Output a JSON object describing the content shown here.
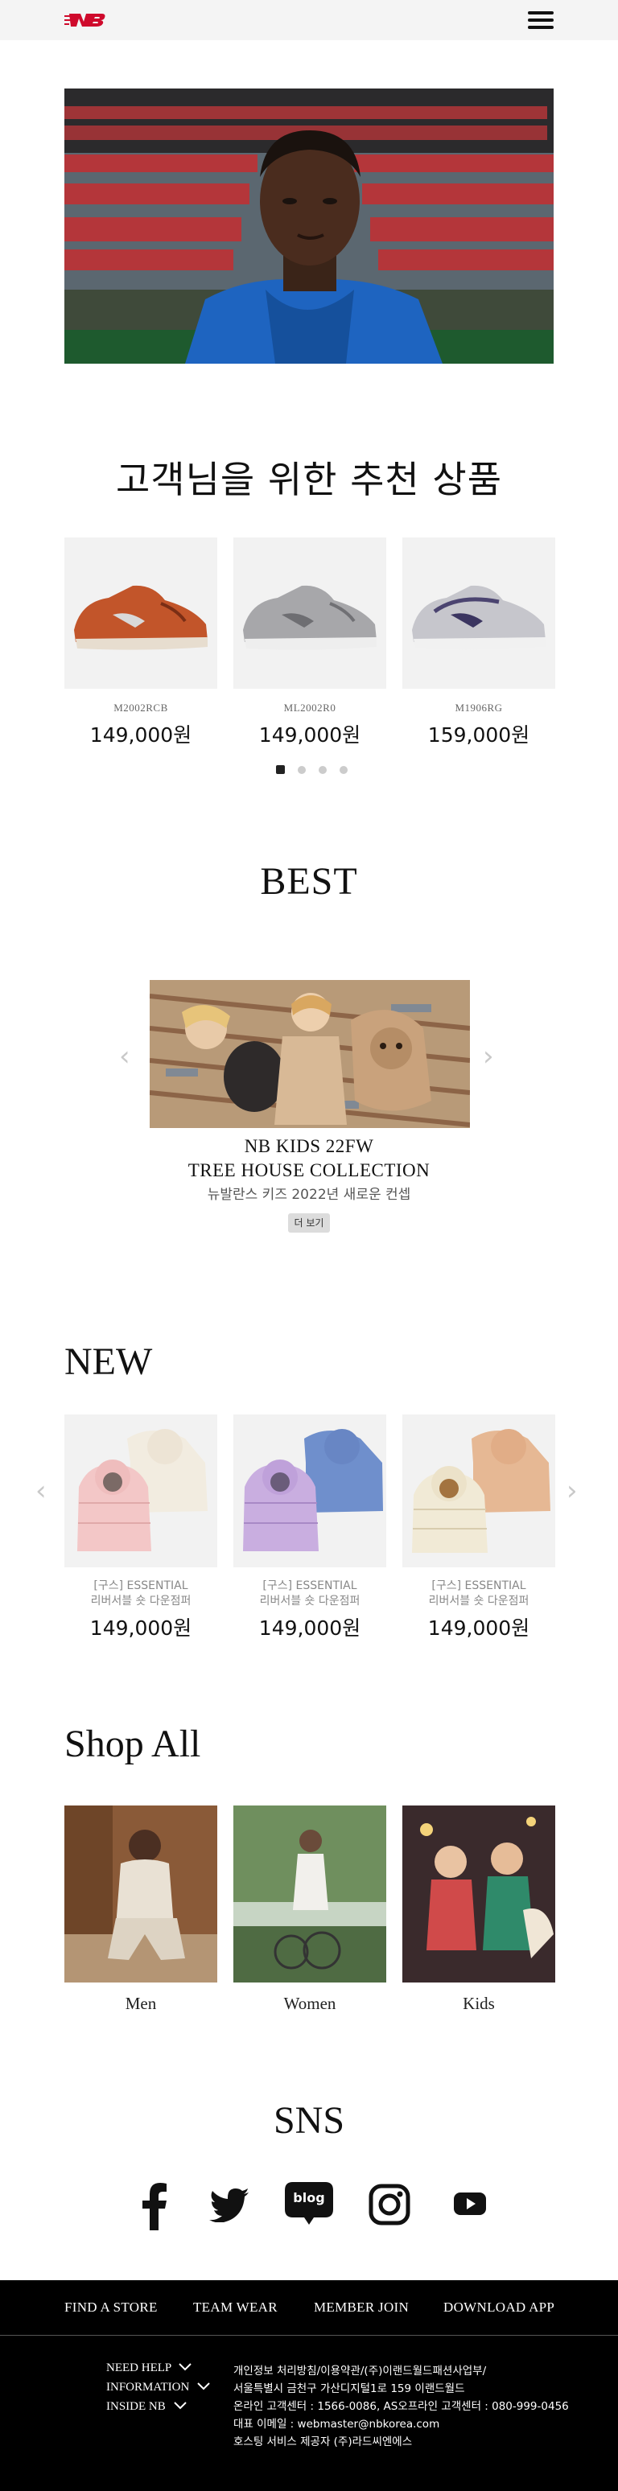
{
  "header": {
    "logo_icon": "new-balance-logo",
    "menu_icon": "hamburger-menu-icon"
  },
  "recommend": {
    "title": "고객님을 위한 추천 상품",
    "products": [
      {
        "code": "M2002RCB",
        "price": "149,000원",
        "color": "#c2552a"
      },
      {
        "code": "ML2002R0",
        "price": "149,000원",
        "color": "#9a9a9c"
      },
      {
        "code": "M1906RG",
        "price": "159,000원",
        "color": "#b9b9c1"
      }
    ],
    "pages": 4,
    "active_page": 0
  },
  "best": {
    "title": "BEST",
    "banner_title": "NB KIDS 22FW",
    "banner_subtitle": "TREE HOUSE COLLECTION",
    "banner_desc": "뉴발란스 키즈 2022년 새로운 컨셉",
    "more_label": "더 보기",
    "prev_icon": "chevron-left-icon",
    "next_icon": "chevron-right-icon"
  },
  "new": {
    "title": "NEW",
    "items": [
      {
        "line1": "[구스] ESSENTIAL",
        "line2": "리버서블 숏 다운점퍼",
        "price": "149,000원"
      },
      {
        "line1": "[구스] ESSENTIAL",
        "line2": "리버서블 숏 다운점퍼",
        "price": "149,000원"
      },
      {
        "line1": "[구스] ESSENTIAL",
        "line2": "리버서블 숏 다운점퍼",
        "price": "149,000원"
      }
    ]
  },
  "shop_all": {
    "title": "Shop All",
    "categories": [
      {
        "label": "Men"
      },
      {
        "label": "Women"
      },
      {
        "label": "Kids"
      }
    ]
  },
  "sns": {
    "title": "SNS",
    "icons": [
      "facebook-icon",
      "twitter-icon",
      "blog-icon",
      "instagram-icon",
      "youtube-icon"
    ],
    "blog_text": "blog"
  },
  "footer": {
    "nav": [
      "FIND A STORE",
      "TEAM WEAR",
      "MEMBER JOIN",
      "DOWNLOAD APP"
    ],
    "menus": [
      "NEED HELP",
      "INFORMATION",
      "INSIDE NB"
    ],
    "info": [
      "개인정보 처리방침/이용약관/(주)이랜드월드패션사업부/",
      "서울특별시 금천구 가산디지털1로 159 이랜드월드",
      "온라인 고객센터 : 1566-0086, AS오프라인 고객센터 : 080-999-0456",
      "대표 이메일 : webmaster@nbkorea.com",
      "호스팅 서비스 제공자 (주)라드씨엔에스"
    ]
  },
  "colors": {
    "brand_red": "#cf0a2c",
    "footer_bg": "#000000"
  }
}
